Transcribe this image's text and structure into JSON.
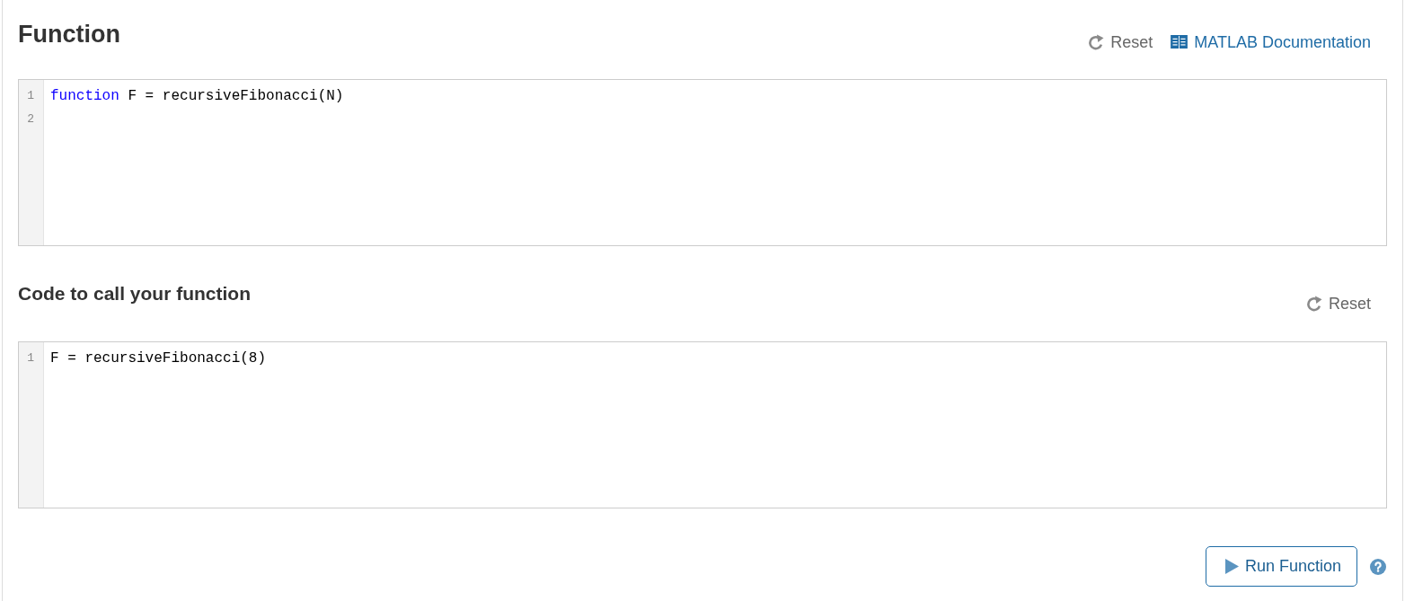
{
  "sections": [
    {
      "kind": "primary",
      "heading": "Function",
      "actions": [
        {
          "kind": "reset",
          "label": "Reset"
        },
        {
          "kind": "docs",
          "label": "MATLAB Documentation"
        }
      ],
      "editor": {
        "lines": [
          {
            "number": "1",
            "tokens": [
              {
                "kind": "keyword",
                "text": "function"
              },
              {
                "kind": "plain",
                "text": " F = recursiveFibonacci(N)"
              }
            ]
          },
          {
            "number": "2"
          }
        ]
      }
    },
    {
      "kind": "secondary",
      "heading": "Code to call your function",
      "actions": [
        {
          "kind": "reset",
          "label": "Reset"
        }
      ],
      "editor": {
        "lines": [
          {
            "number": "1",
            "tokens": [
              {
                "kind": "plain",
                "text": "F = recursiveFibonacci(8)"
              }
            ]
          }
        ]
      }
    }
  ],
  "run_button": {
    "label": "Run Function"
  }
}
